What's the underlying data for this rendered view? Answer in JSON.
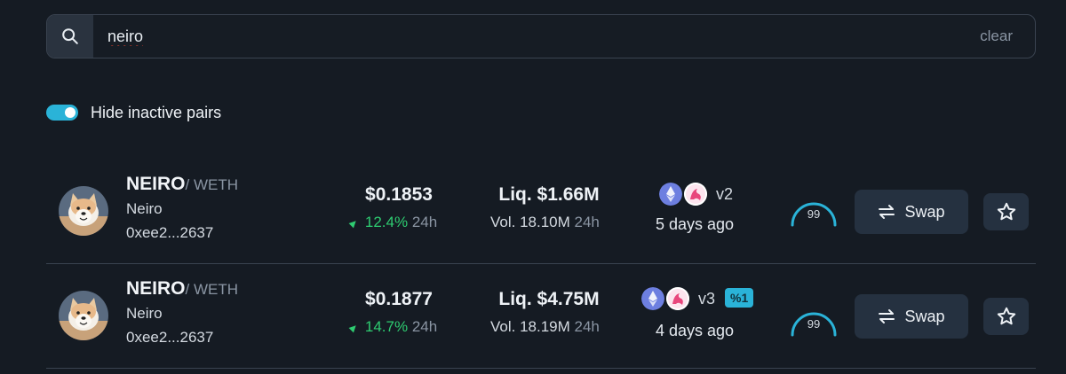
{
  "search": {
    "value": "neiro",
    "clear_label": "clear",
    "icon": "search-icon"
  },
  "filter": {
    "hide_inactive_label": "Hide inactive pairs",
    "hide_inactive_on": true,
    "accent_color": "#2ab3d8"
  },
  "pairs": [
    {
      "symbol": "NEIRO",
      "quote": "/ WETH",
      "name": "Neiro",
      "address": "0xee2...2637",
      "price": "$0.1853",
      "change_pct": "12.4%",
      "change_period": "24h",
      "liquidity": "Liq. $1.66M",
      "volume": "Vol. 18.10M",
      "volume_period": "24h",
      "dex_version": "v2",
      "fee_badge": "",
      "age": "5 days ago",
      "score": "99",
      "swap_label": "Swap"
    },
    {
      "symbol": "NEIRO",
      "quote": "/ WETH",
      "name": "Neiro",
      "address": "0xee2...2637",
      "price": "$0.1877",
      "change_pct": "14.7%",
      "change_period": "24h",
      "liquidity": "Liq. $4.75M",
      "volume": "Vol. 18.19M",
      "volume_period": "24h",
      "dex_version": "v3",
      "fee_badge": "%1",
      "age": "4 days ago",
      "score": "99",
      "swap_label": "Swap"
    }
  ],
  "colors": {
    "background": "#151b23",
    "positive": "#2ecc71",
    "muted": "#8a95a3",
    "button": "#253140"
  }
}
